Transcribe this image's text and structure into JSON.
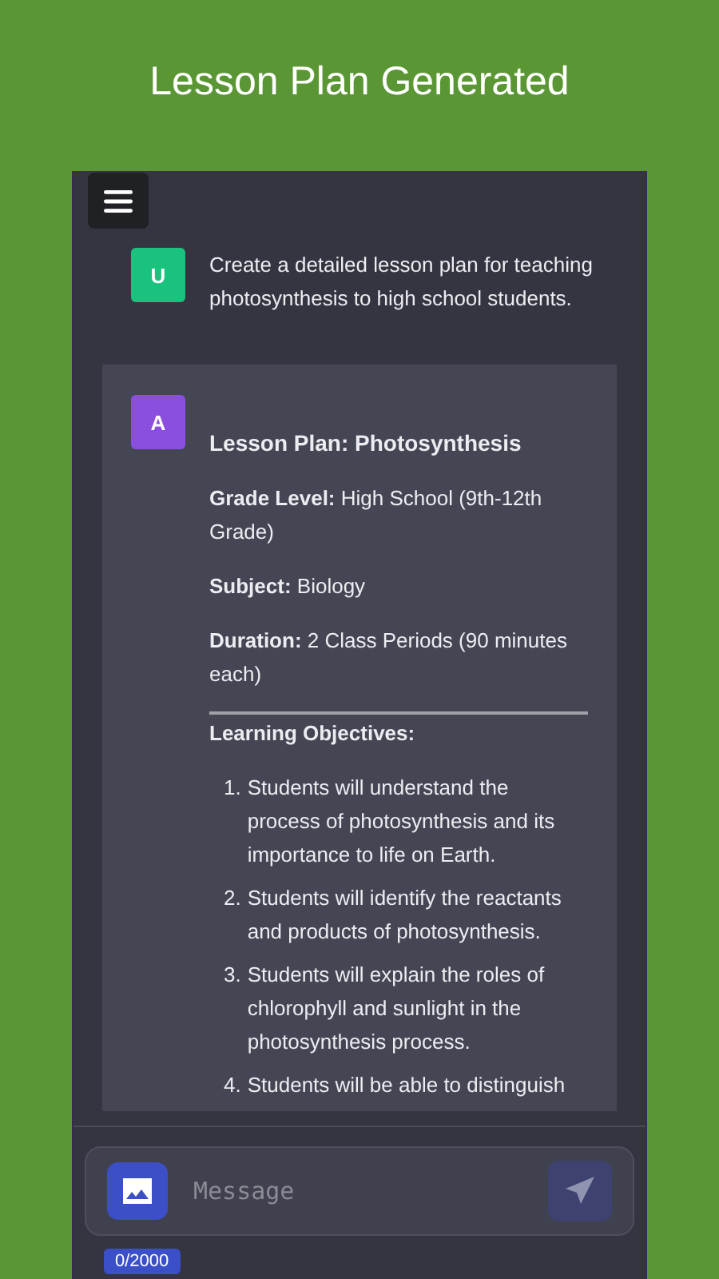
{
  "header": {
    "title": "Lesson Plan Generated"
  },
  "messages": [
    {
      "kind": "user",
      "avatar": "U",
      "color": "#19c37d",
      "blocks": [
        {
          "kind": "paragraph",
          "text": "Create a detailed lesson plan for teaching photosynthesis to high school students."
        }
      ]
    },
    {
      "kind": "assistant",
      "avatar": "A",
      "color": "#8b4fe0",
      "blocks": [
        {
          "kind": "heading",
          "text": "Lesson Plan: Photosynthesis"
        },
        {
          "kind": "paragraph",
          "text": "**Grade Level:** High School (9th-12th Grade)"
        },
        {
          "kind": "paragraph",
          "text": "**Subject:** Biology"
        },
        {
          "kind": "paragraph",
          "text": "**Duration:** 2 Class Periods (90 minutes each)"
        },
        {
          "kind": "rule"
        },
        {
          "kind": "subheading",
          "text": "Learning Objectives:"
        },
        {
          "kind": "list",
          "items": [
            {
              "number": "1.",
              "text": "Students will understand the process of photosynthesis and its importance to life on Earth."
            },
            {
              "number": "2.",
              "text": "Students will identify the reactants and products of photosynthesis."
            },
            {
              "number": "3.",
              "text": "Students will explain the roles of chlorophyll and sunlight in the photosynthesis process."
            },
            {
              "number": "4.",
              "text": "Students will be able to distinguish"
            }
          ]
        }
      ]
    }
  ],
  "composer": {
    "placeholder": "Message",
    "send_disabled": true,
    "counter": "0/2000"
  }
}
